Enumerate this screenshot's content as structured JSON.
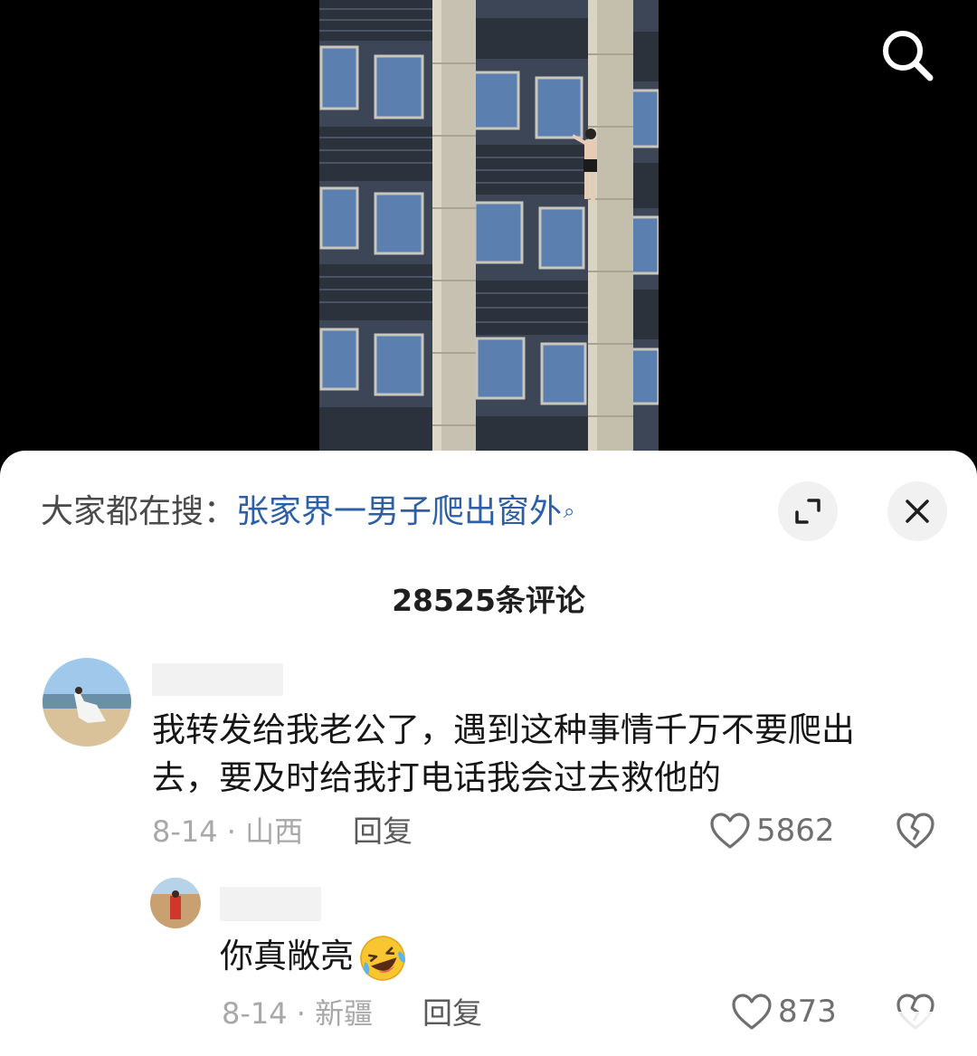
{
  "video": {
    "search_icon": "search-icon"
  },
  "search_bar": {
    "prefix": "大家都在搜：",
    "keyword": "张家界一男子爬出窗外",
    "keyword_icon": "search-small-icon"
  },
  "sheet": {
    "expand_icon": "expand-icon",
    "close_icon": "close-icon",
    "comment_count": "28525条评论"
  },
  "comments": [
    {
      "text": "我转发给我老公了，遇到这种事情千万不要爬出去，要及时给我打电话我会过去救他的",
      "date_location": "8-14 · 山西",
      "reply_label": "回复",
      "likes": "5862",
      "like_icon": "heart-icon",
      "dislike_icon": "broken-heart-icon"
    },
    {
      "text": "你真敞亮",
      "emoji": "laughing-crying-emoji",
      "date_location": "8-14 · 新疆",
      "reply_label": "回复",
      "likes": "873",
      "like_icon": "heart-icon",
      "dislike_icon": "broken-heart-icon"
    }
  ],
  "colors": {
    "keyword": "#2d5fa6",
    "background_top": "#000000",
    "sheet": "#ffffff",
    "meta_text": "#a8a8a8"
  }
}
